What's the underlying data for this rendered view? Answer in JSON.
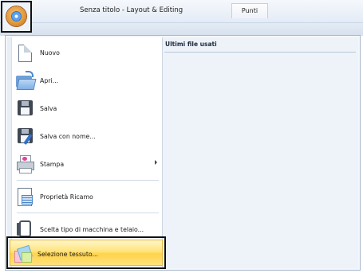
{
  "window": {
    "title": "Senza titolo - Layout & Editing",
    "tab_label": "Punti"
  },
  "app_button": {
    "icon": "app-orb-icon"
  },
  "recent": {
    "header": "Ultimi file usati"
  },
  "menu": {
    "items": [
      {
        "label": "Nuovo",
        "icon": "new-document-icon",
        "has_submenu": false
      },
      {
        "label": "Apri...",
        "icon": "open-folder-icon",
        "has_submenu": false
      },
      {
        "label": "Salva",
        "icon": "save-disk-icon",
        "has_submenu": false
      },
      {
        "label": "Salva con nome...",
        "icon": "save-as-icon",
        "has_submenu": false
      },
      {
        "label": "Stampa",
        "icon": "print-icon",
        "has_submenu": true
      },
      {
        "label": "Proprietà Ricamo",
        "icon": "embroidery-properties-icon",
        "has_submenu": false
      },
      {
        "label": "Scelta tipo di macchina e telaio...",
        "icon": "machine-hoop-icon",
        "has_submenu": false
      },
      {
        "label": "Selezione tessuto...",
        "icon": "fabric-selection-icon",
        "has_submenu": false,
        "highlighted": true
      }
    ]
  },
  "colors": {
    "highlight": "#ffd24a",
    "panel_bg": "#eef3f9",
    "frame": "#111111"
  }
}
